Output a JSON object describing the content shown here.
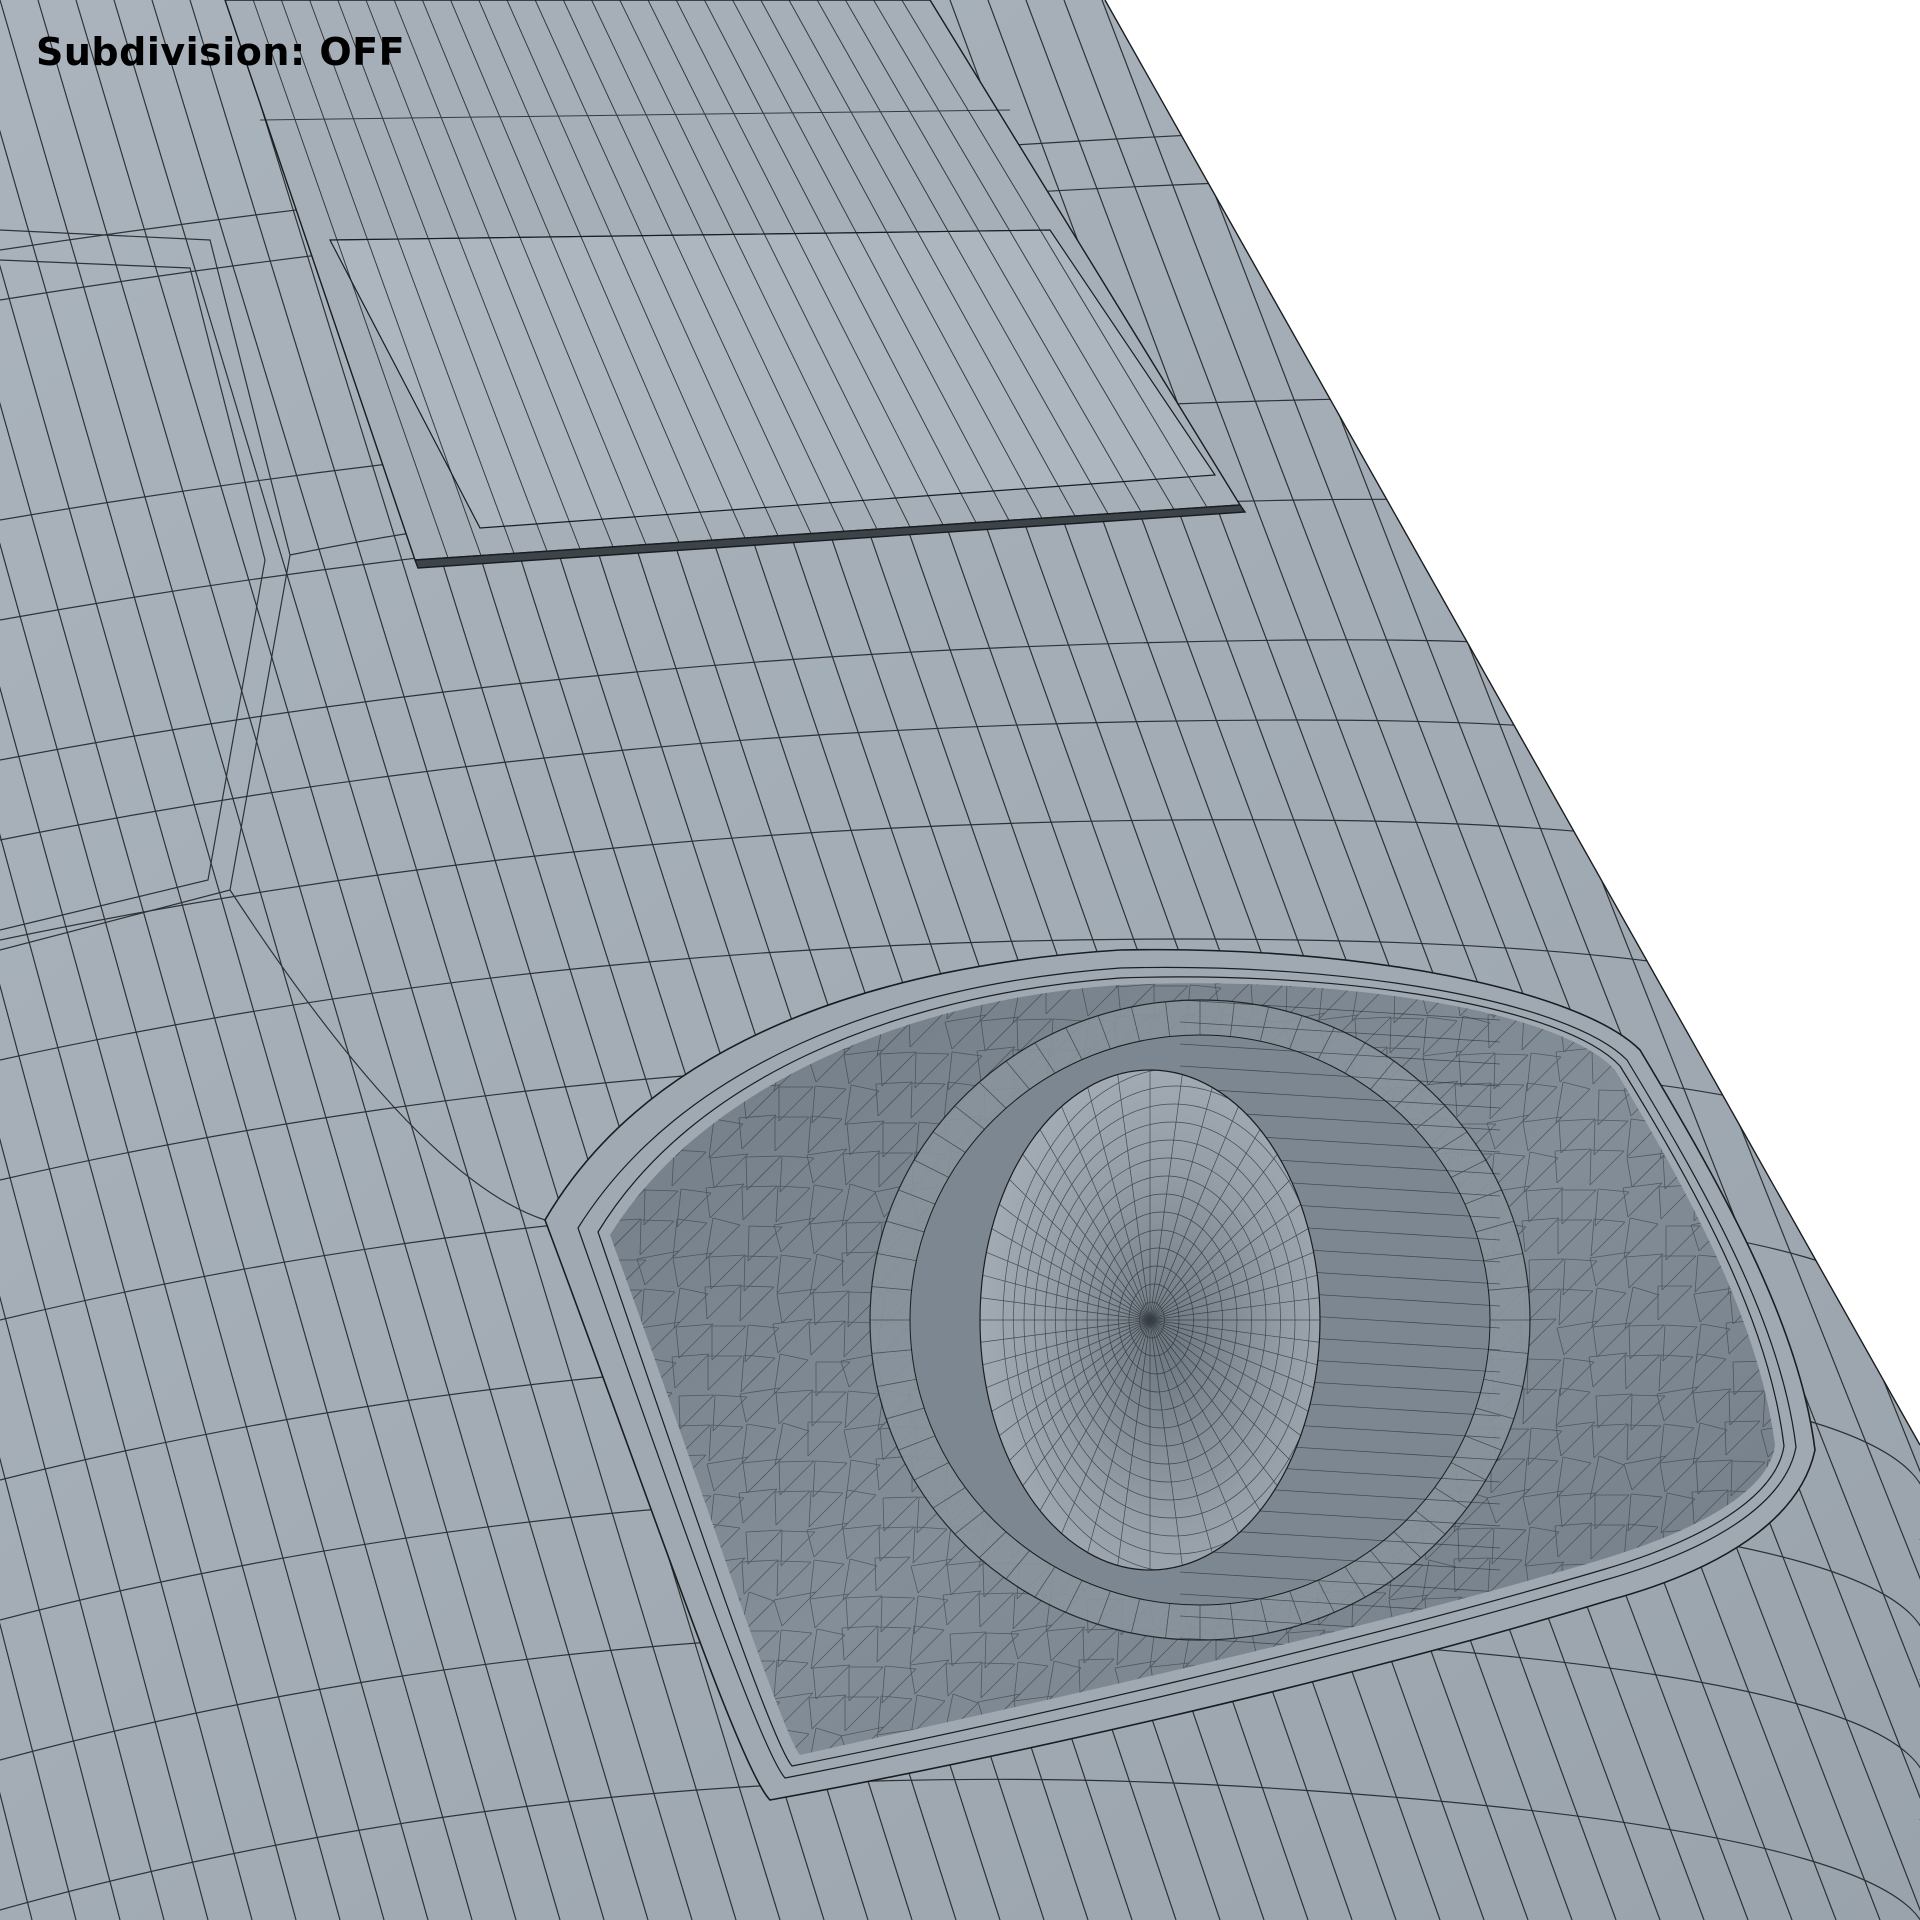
{
  "overlay": {
    "label": "Subdivision: OFF"
  },
  "scene": {
    "subject": "wireframe-3d-model-taillight",
    "colors": {
      "background": "#ffffff",
      "surface": "#a8b1ba",
      "surface_light": "#b9c1c9",
      "surface_dark": "#8f99a3",
      "lens": "#7c8690",
      "lens_dark": "#68727c",
      "bulb": "#98a1aa",
      "wire": "#1a1d20"
    }
  }
}
